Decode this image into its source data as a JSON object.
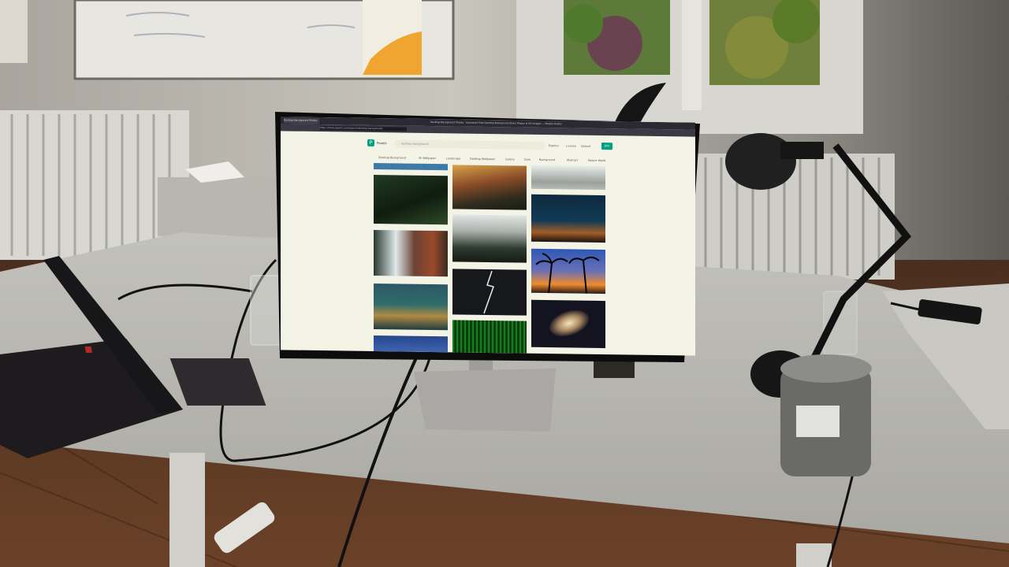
{
  "browser": {
    "tab_title": "Desktop Background Photos",
    "window_title": "Desktop Background Photos · Download Free Desktop Background Stock Photos & HD Images — Mozilla Firefox",
    "url": "https://www.pexels.com/search/desktop background/"
  },
  "site": {
    "brand": "Pexels",
    "logo_letter": "P",
    "search_placeholder": "desktop background",
    "nav": [
      "Explore",
      "License",
      "Upload",
      "Join"
    ],
    "tags": [
      "Desktop Background",
      "4k Wallpaper",
      "Landscape",
      "Desktop Wallpaper",
      "Galaxy",
      "Dark",
      "Background",
      "Abstract",
      "Nature World"
    ]
  },
  "photos": {
    "column_1": [
      "jungle-leaves",
      "waterfall-cliff",
      "city-aerial",
      "palm-sunset-partial"
    ],
    "column_2": [
      "canyon-sunset",
      "misty-forest",
      "lightning-storm",
      "matrix-green"
    ],
    "column_3": [
      "snowy-clouds",
      "night-city",
      "palm-beach-sunset",
      "galaxy"
    ]
  },
  "colors": {
    "brand_green": "#05a081",
    "screen_bg": "#f3f3e6",
    "desk": "#cbcbc5",
    "wall": "#d3d0c8"
  }
}
